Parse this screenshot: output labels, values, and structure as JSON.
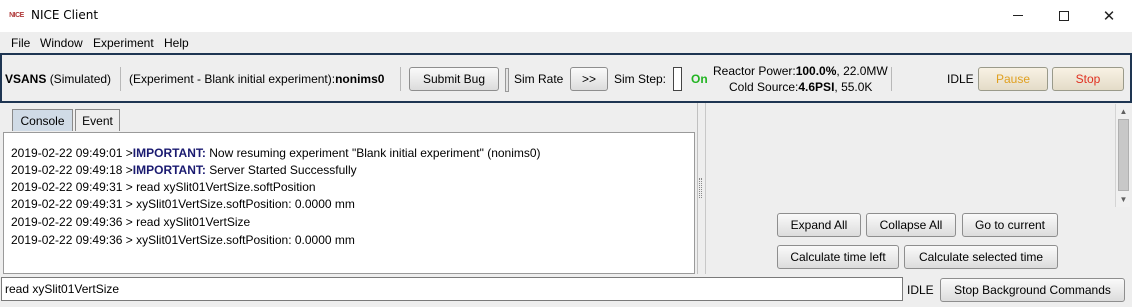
{
  "window": {
    "title": "NICE Client",
    "app_icon_text": "NICE",
    "minimize_glyph": "—",
    "maximize_glyph": "☐",
    "close_glyph": "✕"
  },
  "menu": [
    "File",
    "Window",
    "Experiment",
    "Help"
  ],
  "toolbar": {
    "instrument": "VSANS",
    "instrument_mode": "(Simulated)",
    "experiment_prefix": "(Experiment - Blank initial experiment):",
    "experiment_id": "nonims0",
    "submit_bug": "Submit Bug",
    "handle_glyph": "..",
    "sim_rate_label": "Sim Rate",
    "sim_rate_button": ">>",
    "sim_step_label": "Sim Step:",
    "on_label": "On",
    "reactor_power_label": "Reactor Power:",
    "reactor_power_percent": "100.0%",
    "reactor_power_mw": ", 22.0MW",
    "cold_source_label": "Cold Source:",
    "cold_source_psi": "4.6PSI",
    "cold_source_k": ", 55.0K",
    "status": "IDLE",
    "pause": "Pause",
    "stop": "Stop"
  },
  "tabs": [
    {
      "label": "Console",
      "active": true
    },
    {
      "label": "Event",
      "active": false
    }
  ],
  "console_lines": [
    {
      "ts": "2019-02-22 09:49:01 >",
      "important": "IMPORTANT:",
      "text": " Now resuming experiment \"Blank initial experiment\" (nonims0)"
    },
    {
      "ts": "2019-02-22 09:49:18 >",
      "important": "IMPORTANT:",
      "text": " Server Started Successfully"
    },
    {
      "ts": "2019-02-22 09:49:31 >",
      "important": "",
      "text": " read xySlit01VertSize.softPosition"
    },
    {
      "ts": "2019-02-22 09:49:31 >",
      "important": "",
      "text": " xySlit01VertSize.softPosition: 0.0000 mm"
    },
    {
      "ts": "2019-02-22 09:49:36 >",
      "important": "",
      "text": " read xySlit01VertSize"
    },
    {
      "ts": "2019-02-22 09:49:36 >",
      "important": "",
      "text": " xySlit01VertSize.softPosition: 0.0000 mm"
    }
  ],
  "right_panel": {
    "expand_all": "Expand All",
    "collapse_all": "Collapse All",
    "go_to_current": "Go to current",
    "calc_time_left": "Calculate time left",
    "calc_selected_time": "Calculate selected time",
    "scroll_up_glyph": "▲",
    "scroll_down_glyph": "▼"
  },
  "command_bar": {
    "input_value": "read xySlit01VertSize",
    "status": "IDLE",
    "stop_background": "Stop Background Commands"
  }
}
